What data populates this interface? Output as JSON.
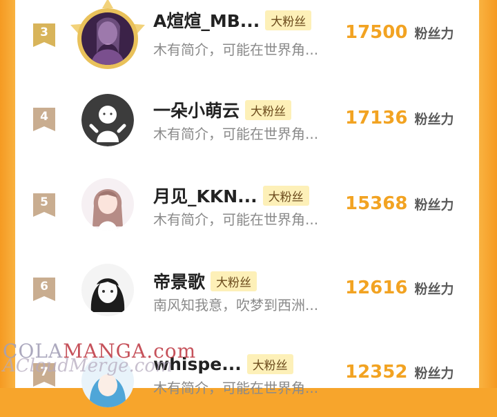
{
  "unit_label": "粉丝力",
  "fan_tag": "大粉丝",
  "watermark": {
    "line1_part1": "COLA",
    "line1_part2": "MANGA",
    "line1_part3": ".com",
    "line2": "ACloudMerge.com"
  },
  "entries": [
    {
      "rank": "3",
      "name": "A煊煊_MB...",
      "bio": "木有简介，可能在世界角...",
      "score": "17500",
      "unit": "粉丝力",
      "tag": "大粉丝"
    },
    {
      "rank": "4",
      "name": "一朵小萌云",
      "bio": "木有简介，可能在世界角...",
      "score": "17136",
      "unit": "粉丝力",
      "tag": "大粉丝"
    },
    {
      "rank": "5",
      "name": "月见_KKN...",
      "bio": "木有简介，可能在世界角...",
      "score": "15368",
      "unit": "粉丝力",
      "tag": "大粉丝"
    },
    {
      "rank": "6",
      "name": "帝景歌",
      "bio": "南风知我意，吹梦到西洲...",
      "score": "12616",
      "unit": "粉丝力",
      "tag": "大粉丝"
    },
    {
      "rank": "7",
      "name": "whispe...",
      "bio": "木有简介，可能在世界角...",
      "score": "12352",
      "unit": "粉丝力",
      "tag": "大粉丝"
    }
  ],
  "colors": {
    "frame": "#f7a52c",
    "score": "#f2a322",
    "badge_gold": "#d8b45a",
    "badge_tan": "#c9ad90",
    "tag_bg": "#fdf0b8"
  }
}
